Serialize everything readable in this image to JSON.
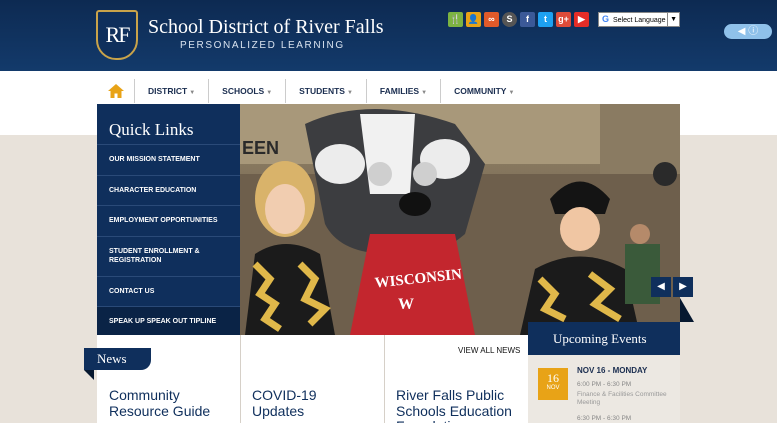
{
  "header": {
    "logo_text": "RF",
    "title": "School District of River Falls",
    "tagline": "PERSONALIZED LEARNING",
    "language_label": "Select Language",
    "language_arrow": "▼"
  },
  "social": [
    {
      "icon": "utensils-icon",
      "glyph": "🍴",
      "color": "#7cb342"
    },
    {
      "icon": "user-icon",
      "glyph": "👤",
      "color": "#e8a317"
    },
    {
      "icon": "link-icon",
      "glyph": "∞",
      "color": "#e05a2a"
    },
    {
      "icon": "s-icon",
      "glyph": "S",
      "color": "#555555"
    },
    {
      "icon": "facebook-icon",
      "glyph": "f",
      "color": "#3b5998"
    },
    {
      "icon": "twitter-icon",
      "glyph": "t",
      "color": "#1da1f2"
    },
    {
      "icon": "google-plus-icon",
      "glyph": "g+",
      "color": "#dd4b39"
    },
    {
      "icon": "youtube-icon",
      "glyph": "▶",
      "color": "#e52d27"
    }
  ],
  "nav": {
    "home_icon": "home-icon",
    "items": [
      "DISTRICT",
      "SCHOOLS",
      "STUDENTS",
      "FAMILIES",
      "COMMUNITY"
    ]
  },
  "quick_links": {
    "title": "Quick Links",
    "items": [
      "OUR MISSION STATEMENT",
      "CHARACTER EDUCATION",
      "EMPLOYMENT OPPORTUNITIES",
      "STUDENT ENROLLMENT & REGISTRATION",
      "CONTACT US",
      "SPEAK UP SPEAK OUT TIPLINE"
    ]
  },
  "hero": {
    "shirt_text": "WISCONSIN",
    "banner_text": "EEN",
    "prev": "◀",
    "next": "▶"
  },
  "news": {
    "tab": "News",
    "view_all": "VIEW ALL NEWS",
    "items": [
      {
        "title": "Community Resource Guide"
      },
      {
        "title": "COVID-19 Updates"
      },
      {
        "title": "River Falls Public Schools Education Foundation"
      }
    ]
  },
  "events": {
    "title": "Upcoming Events",
    "date_day": "16",
    "date_month": "NOV",
    "heading": "NOV 16 - MONDAY",
    "list": [
      {
        "time": "6:00 PM - 6:30 PM",
        "name": "Finance & Facilities Committee Meeting"
      },
      {
        "time": "6:30 PM - 6:30 PM",
        "name": ""
      }
    ]
  },
  "accessibility_label": "◀ ⓘ"
}
